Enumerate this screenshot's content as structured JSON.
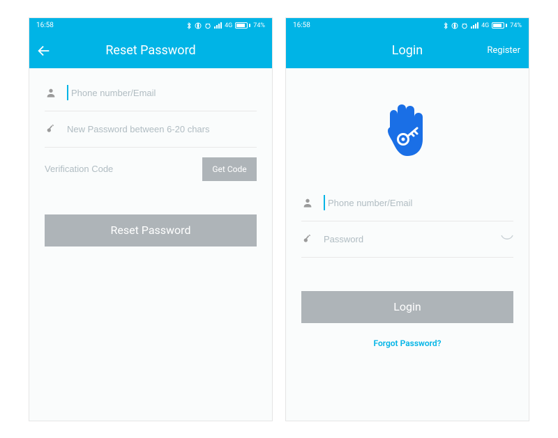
{
  "status": {
    "time": "16:58",
    "network": "4G",
    "battery_pct": "74%"
  },
  "reset": {
    "title": "Reset Password",
    "phone_placeholder": "Phone number/Email",
    "password_placeholder": "New Password between 6-20 chars",
    "verification_placeholder": "Verification Code",
    "get_code_label": "Get Code",
    "submit_label": "Reset Password"
  },
  "login": {
    "title": "Login",
    "register_label": "Register",
    "phone_placeholder": "Phone number/Email",
    "password_placeholder": "Password",
    "submit_label": "Login",
    "forgot_label": "Forgot Password?"
  },
  "colors": {
    "accent": "#00b4e6",
    "button_gray": "#aeb4b8",
    "logo_blue": "#1a6fe6"
  }
}
